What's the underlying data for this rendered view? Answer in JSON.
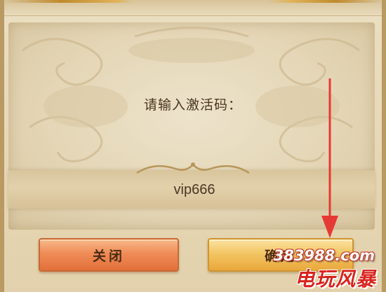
{
  "dialog": {
    "prompt": "请输入激活码：",
    "code_value": "vip666"
  },
  "buttons": {
    "close_label": "关闭",
    "confirm_label": "确定"
  },
  "watermark": {
    "line1": "383988.com",
    "line2": "电玩风暴"
  },
  "colors": {
    "close_button": "#ef8c57",
    "confirm_button": "#f3c564",
    "arrow": "#e53935",
    "text": "#4b3520"
  }
}
